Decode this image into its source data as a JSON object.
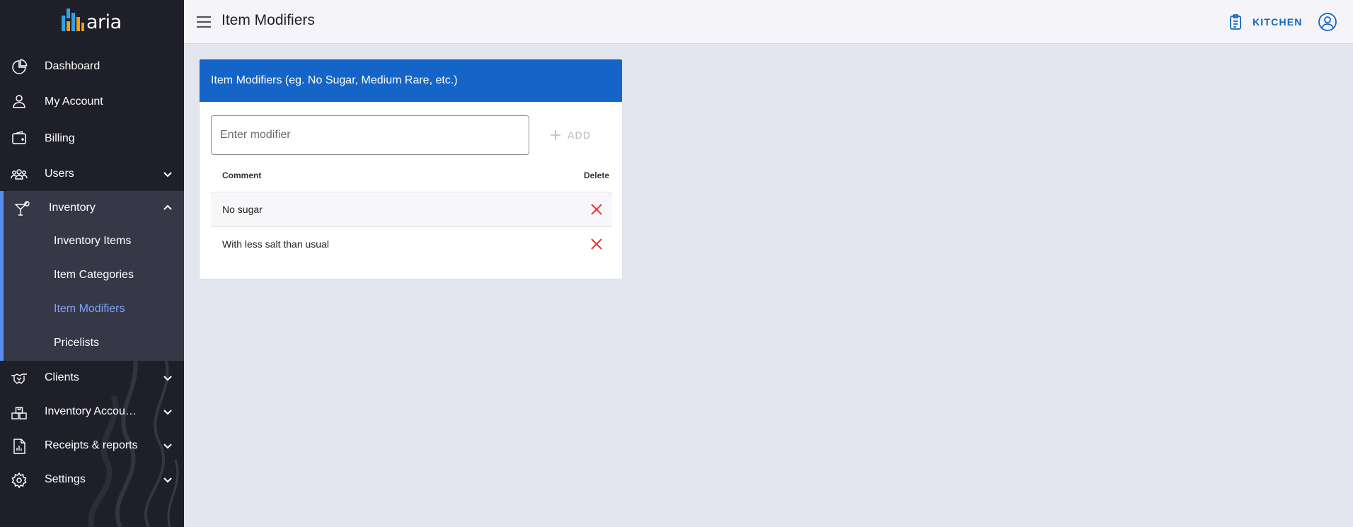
{
  "app": {
    "logo_text": "aria",
    "brand_color": "#1565c9",
    "accent_color": "#5b8df0"
  },
  "header": {
    "title": "Item Modifiers",
    "kitchen_label": "KITCHEN",
    "icons": {
      "menu": "hamburger-icon",
      "kitchen": "clipboard-icon",
      "account": "account-circle-icon"
    }
  },
  "sidebar": {
    "items": [
      {
        "label": "Dashboard",
        "icon": "pie-chart-icon"
      },
      {
        "label": "My Account",
        "icon": "person-icon"
      },
      {
        "label": "Billing",
        "icon": "wallet-icon"
      },
      {
        "label": "Users",
        "icon": "group-icon"
      },
      {
        "label": "Inventory",
        "icon": "cocktail-icon"
      },
      {
        "label": "Clients",
        "icon": "handshake-icon"
      },
      {
        "label": "Inventory Accou…",
        "icon": "boxes-icon"
      },
      {
        "label": "Receipts & reports",
        "icon": "report-icon"
      },
      {
        "label": "Settings",
        "icon": "gear-icon"
      }
    ],
    "inventory_sub": [
      {
        "label": "Inventory Items"
      },
      {
        "label": "Item Categories"
      },
      {
        "label": "Item Modifiers",
        "active": true
      },
      {
        "label": "Pricelists"
      }
    ]
  },
  "card": {
    "title": "Item Modifiers (eg. No Sugar, Medium Rare, etc.)",
    "input_placeholder": "Enter modifier",
    "input_value": "",
    "add_label": "ADD",
    "columns": {
      "comment": "Comment",
      "delete": "Delete"
    },
    "rows": [
      {
        "comment": "No sugar"
      },
      {
        "comment": "With less salt than usual"
      }
    ],
    "delete_color": "#e53935"
  }
}
